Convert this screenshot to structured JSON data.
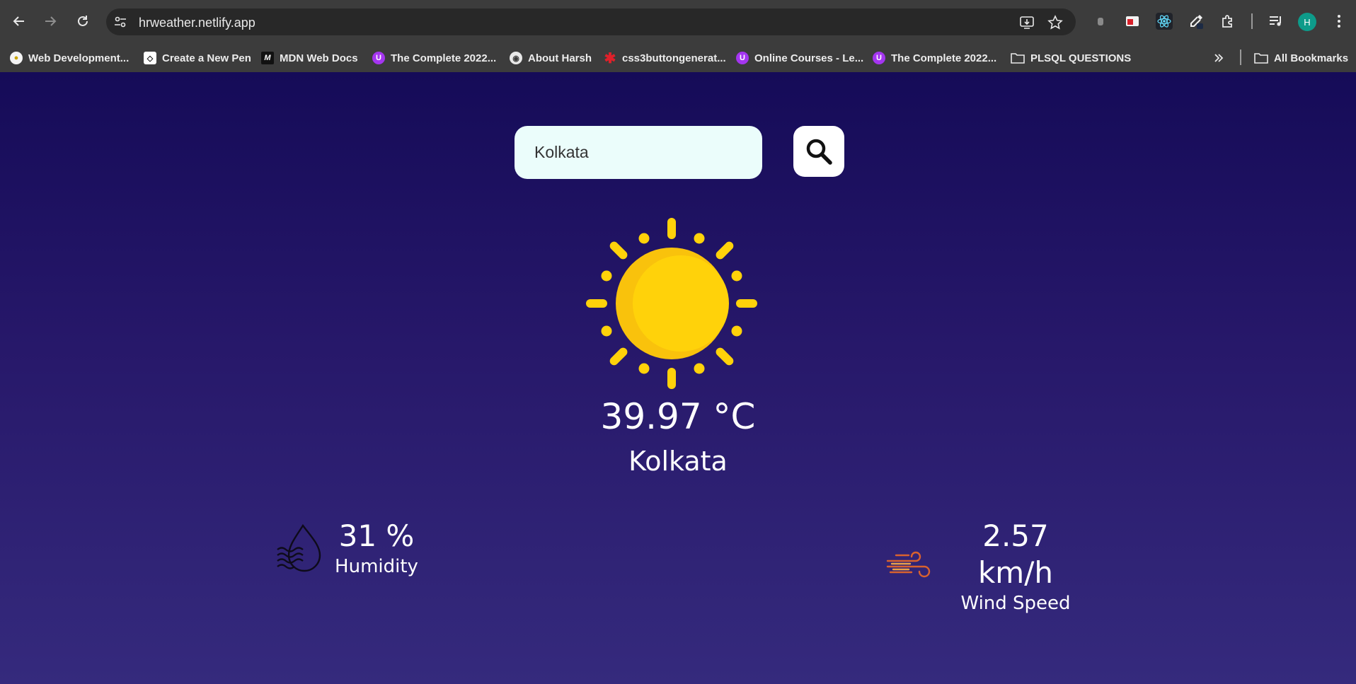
{
  "browser": {
    "url": "hrweather.netlify.app",
    "avatar_letter": "H",
    "bookmarks": [
      {
        "label": "Web Development...",
        "icon": "bulb-icon"
      },
      {
        "label": "Create a New Pen",
        "icon": "codepen-icon"
      },
      {
        "label": "MDN Web Docs",
        "icon": "mdn-icon"
      },
      {
        "label": "The Complete 2022...",
        "icon": "udemy-icon"
      },
      {
        "label": "About Harsh",
        "icon": "globe-icon"
      },
      {
        "label": "css3buttongenerat...",
        "icon": "star-burst-icon"
      },
      {
        "label": "Online Courses - Le...",
        "icon": "udemy-icon"
      },
      {
        "label": "The Complete 2022...",
        "icon": "udemy-icon"
      },
      {
        "label": "PLSQL QUESTIONS",
        "icon": "folder-icon"
      }
    ],
    "all_bookmarks_label": "All Bookmarks"
  },
  "search": {
    "value": "Kolkata"
  },
  "weather": {
    "icon": "sun-icon",
    "temperature": "39.97 °C",
    "city": "Kolkata",
    "humidity": {
      "value": "31 %",
      "label": "Humidity",
      "icon": "humidity-icon"
    },
    "wind": {
      "value": "2.57 km/h",
      "label": "Wind Speed",
      "icon": "wind-icon"
    }
  },
  "colors": {
    "background_top": "#150b58",
    "background_bottom": "#352a7d",
    "sun": "#ffd20a",
    "search_bg": "#ebfdfb"
  }
}
